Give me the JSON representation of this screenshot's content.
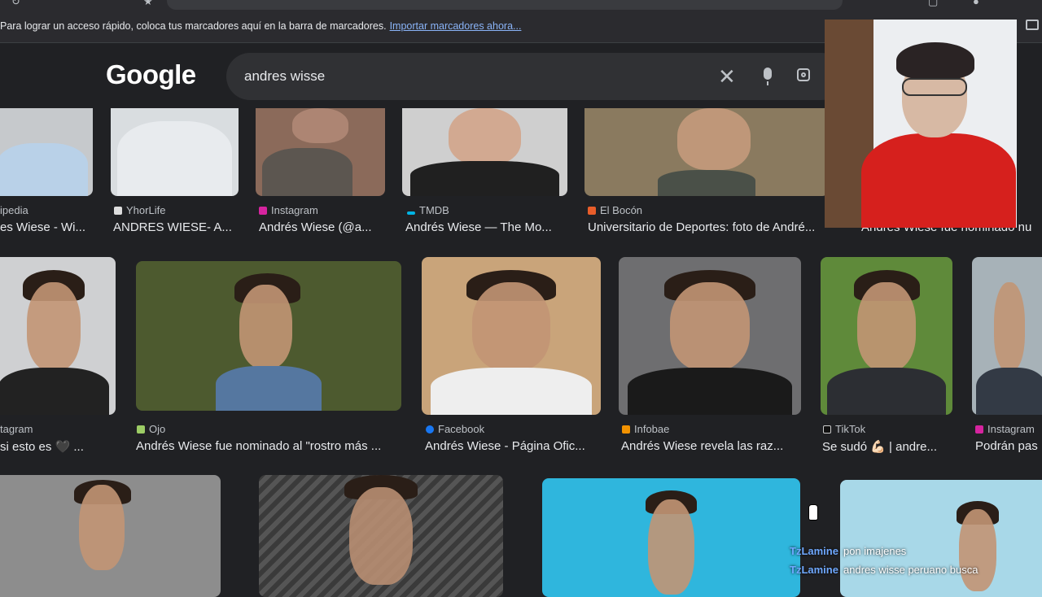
{
  "bookmarks_bar": {
    "message": "Para lograr un acceso rápido, coloca tus marcadores aquí en la barra de marcadores.",
    "import_link": "Importar marcadores ahora..."
  },
  "logo": "Google",
  "search": {
    "query": "andres wisse"
  },
  "results": {
    "row1": [
      {
        "source": "ipedia",
        "title": "es Wiese - Wi..."
      },
      {
        "source": "YhorLife",
        "title": "ANDRES WIESE- A..."
      },
      {
        "source": "Instagram",
        "title": "Andrés Wiese (@a..."
      },
      {
        "source": "TMDB",
        "title": "Andrés Wiese — The Mo..."
      },
      {
        "source": "El Bocón",
        "title": "Universitario de Deportes: foto de André..."
      },
      {
        "source": "",
        "title": "Andrés Wiese fue nominado nu"
      }
    ],
    "row2": [
      {
        "source": "tagram",
        "title": "si esto es 🖤 ..."
      },
      {
        "source": "Ojo",
        "title": "Andrés Wiese fue nominado al \"rostro más ..."
      },
      {
        "source": "Facebook",
        "title": "Andrés Wiese - Página Ofic..."
      },
      {
        "source": "Infobae",
        "title": "Andrés Wiese revela las raz..."
      },
      {
        "source": "TikTok",
        "title": "Se sudó 💪🏻 | andre..."
      },
      {
        "source": "Instagram",
        "title": "Podrán pas"
      }
    ]
  },
  "chat": [
    {
      "user": "TzLamine",
      "message": "pon imajenes"
    },
    {
      "user": "TzLamine",
      "message": "andres wisse peruano busca"
    }
  ],
  "colors": {
    "background": "#202124",
    "link": "#8ab4f8",
    "chat_user": "#6fa8ff",
    "webcam_shirt": "#d6201d"
  }
}
